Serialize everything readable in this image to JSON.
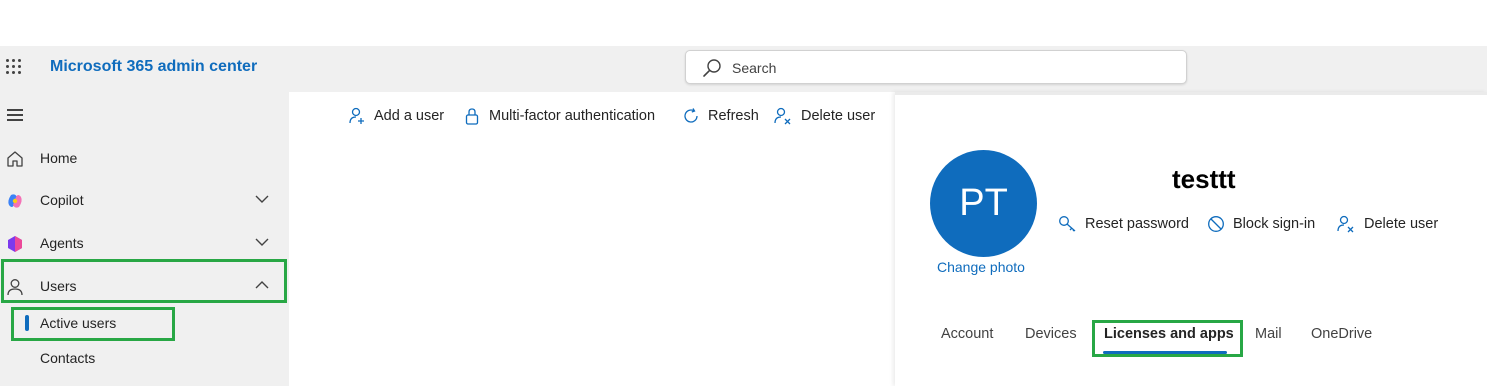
{
  "header": {
    "app_title": "Microsoft 365 admin center",
    "search_placeholder": "Search"
  },
  "sidebar": {
    "items": [
      {
        "label": "Home",
        "icon": "home-icon"
      },
      {
        "label": "Copilot",
        "icon": "copilot-icon",
        "expanded": false
      },
      {
        "label": "Agents",
        "icon": "agents-icon",
        "expanded": false
      },
      {
        "label": "Users",
        "icon": "person-icon",
        "expanded": true
      }
    ],
    "sub_items": [
      {
        "label": "Active users",
        "selected": true
      },
      {
        "label": "Contacts",
        "selected": false
      }
    ]
  },
  "command_bar": {
    "add_user": "Add a user",
    "mfa": "Multi-factor authentication",
    "refresh": "Refresh",
    "delete_user": "Delete user"
  },
  "user_panel": {
    "initials": "PT",
    "change_photo": "Change photo",
    "display_name": "testtt",
    "actions": {
      "reset_password": "Reset password",
      "block_sign_in": "Block sign-in",
      "delete_user": "Delete user"
    },
    "tabs": [
      "Account",
      "Devices",
      "Licenses and apps",
      "Mail",
      "OneDrive"
    ],
    "active_tab": "Licenses and apps"
  },
  "colors": {
    "accent": "#0f6cbd",
    "highlight": "#28a745",
    "chrome": "#f0f0f0"
  }
}
